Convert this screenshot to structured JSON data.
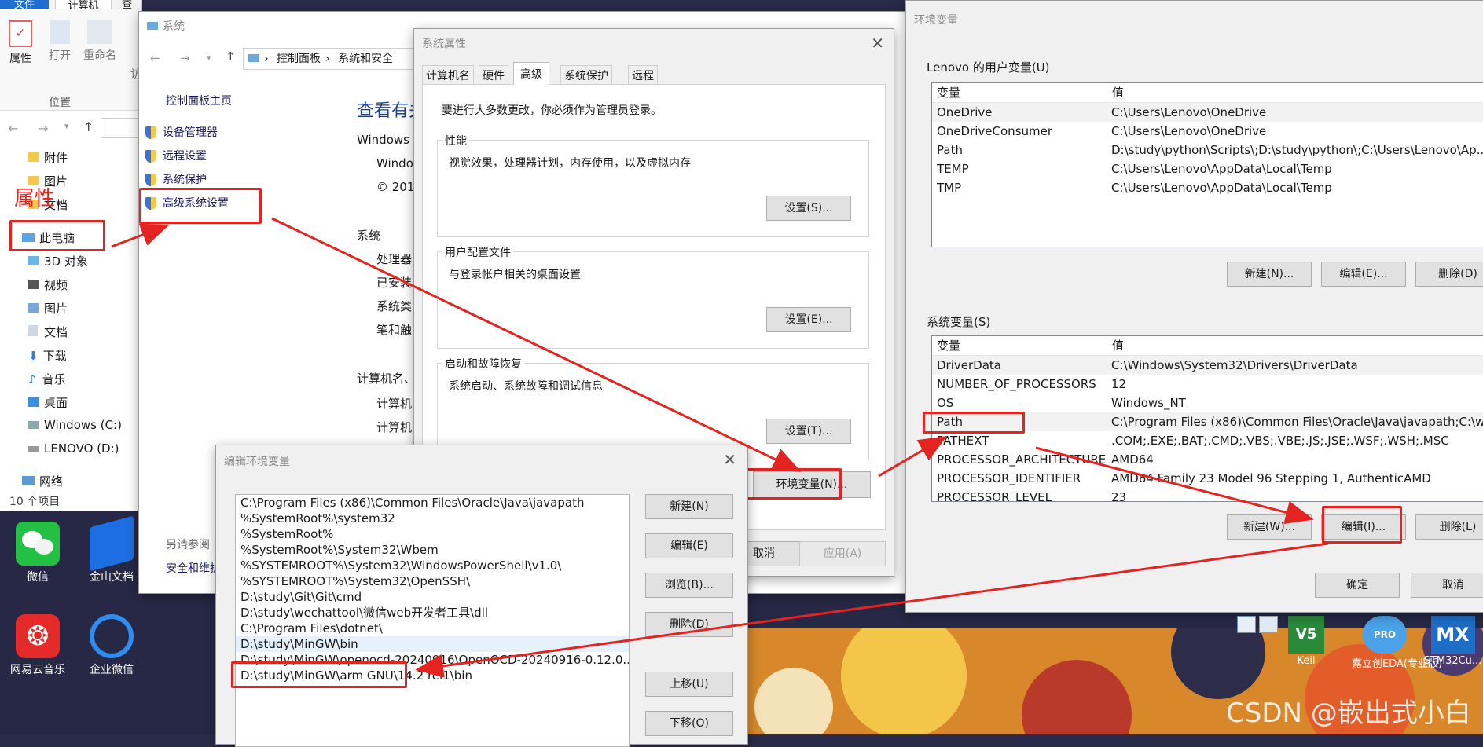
{
  "explorer": {
    "tabs": [
      "文件",
      "计算机",
      "查看"
    ],
    "ribbon": [
      "属性",
      "打开",
      "重命名",
      "访"
    ],
    "group_label": "位置",
    "tree": [
      "附件",
      "图片",
      "文档",
      "此电脑",
      "3D 对象",
      "视频",
      "图片",
      "文档",
      "下载",
      "音乐",
      "桌面",
      "Windows (C:)",
      "LENOVO (D:)",
      "网络"
    ],
    "status": "10 个项目",
    "annotation": "属性"
  },
  "desktop": {
    "icons": [
      "微信",
      "金山文档",
      "网易云音乐",
      "企业微信"
    ],
    "right_icons": [
      "Keil",
      "嘉立创EDA(专业版)",
      "STM32Cu..."
    ],
    "badges": [
      "V5",
      "PRO",
      "MX"
    ]
  },
  "system": {
    "title": "系统",
    "breadcrumb": [
      "控制面板",
      "系统和安全"
    ],
    "left_links": [
      "控制面板主页",
      "设备管理器",
      "远程设置",
      "系统保护",
      "高级系统设置"
    ],
    "see_also": "另请参阅",
    "see_also_link": "安全和维护",
    "heading": "查看有关",
    "lines": [
      "Windows 版",
      "Windo",
      "© 201",
      "系统",
      "处理器",
      "已安装",
      "系统类",
      "笔和触",
      "计算机名、",
      "计算机",
      "计算机"
    ]
  },
  "sysprops": {
    "title": "系统属性",
    "tabs": [
      "计算机名",
      "硬件",
      "高级",
      "系统保护",
      "远程"
    ],
    "active_tab": "高级",
    "notice": "要进行大多数更改，你必须作为管理员登录。",
    "groups": [
      {
        "title": "性能",
        "desc": "视觉效果，处理器计划，内存使用，以及虚拟内存",
        "button": "设置(S)..."
      },
      {
        "title": "用户配置文件",
        "desc": "与登录帐户相关的桌面设置",
        "button": "设置(E)..."
      },
      {
        "title": "启动和故障恢复",
        "desc": "系统启动、系统故障和调试信息",
        "button": "设置(T)..."
      }
    ],
    "env_button": "环境变量(N)...",
    "cancel": "取消",
    "apply": "应用(A)"
  },
  "envvars": {
    "title": "环境变量",
    "user_label": "Lenovo 的用户变量(U)",
    "col_var": "变量",
    "col_val": "值",
    "user_vars": [
      {
        "name": "OneDrive",
        "value": "C:\\Users\\Lenovo\\OneDrive"
      },
      {
        "name": "OneDriveConsumer",
        "value": "C:\\Users\\Lenovo\\OneDrive"
      },
      {
        "name": "Path",
        "value": "D:\\study\\python\\Scripts\\;D:\\study\\python\\;C:\\Users\\Lenovo\\Ap..."
      },
      {
        "name": "TEMP",
        "value": "C:\\Users\\Lenovo\\AppData\\Local\\Temp"
      },
      {
        "name": "TMP",
        "value": "C:\\Users\\Lenovo\\AppData\\Local\\Temp"
      }
    ],
    "user_buttons": [
      "新建(N)...",
      "编辑(E)...",
      "删除(D)"
    ],
    "sys_label": "系统变量(S)",
    "sys_vars": [
      {
        "name": "DriverData",
        "value": "C:\\Windows\\System32\\Drivers\\DriverData"
      },
      {
        "name": "NUMBER_OF_PROCESSORS",
        "value": "12"
      },
      {
        "name": "OS",
        "value": "Windows_NT"
      },
      {
        "name": "Path",
        "value": "C:\\Program Files (x86)\\Common Files\\Oracle\\Java\\javapath;C:\\w..."
      },
      {
        "name": "PATHEXT",
        "value": ".COM;.EXE;.BAT;.CMD;.VBS;.VBE;.JS;.JSE;.WSF;.WSH;.MSC"
      },
      {
        "name": "PROCESSOR_ARCHITECTURE",
        "value": "AMD64"
      },
      {
        "name": "PROCESSOR_IDENTIFIER",
        "value": "AMD64 Family 23 Model 96 Stepping 1, AuthenticAMD"
      },
      {
        "name": "PROCESSOR_LEVEL",
        "value": "23"
      }
    ],
    "sys_buttons": [
      "新建(W)...",
      "编辑(I)...",
      "删除(L)"
    ],
    "ok": "确定",
    "cancel": "取消"
  },
  "editenv": {
    "title": "编辑环境变量",
    "items": [
      "C:\\Program Files (x86)\\Common Files\\Oracle\\Java\\javapath",
      "%SystemRoot%\\system32",
      "%SystemRoot%",
      "%SystemRoot%\\System32\\Wbem",
      "%SYSTEMROOT%\\System32\\WindowsPowerShell\\v1.0\\",
      "%SYSTEMROOT%\\System32\\OpenSSH\\",
      "D:\\study\\Git\\Git\\cmd",
      "D:\\study\\wechattool\\微信web开发者工具\\dll",
      "C:\\Program Files\\dotnet\\",
      "D:\\study\\MinGW\\bin",
      "D:\\study\\MinGW\\openocd-20240916\\OpenOCD-20240916-0.12.0...",
      "D:\\study\\MinGW\\arm GNU\\14.2 rel1\\bin"
    ],
    "buttons": [
      "新建(N)",
      "编辑(E)",
      "浏览(B)...",
      "删除(D)",
      "上移(U)",
      "下移(O)"
    ]
  },
  "watermark": "CSDN @嵌出式小白",
  "colors": {
    "accent": "#0078d7",
    "annotation": "#e32420"
  }
}
